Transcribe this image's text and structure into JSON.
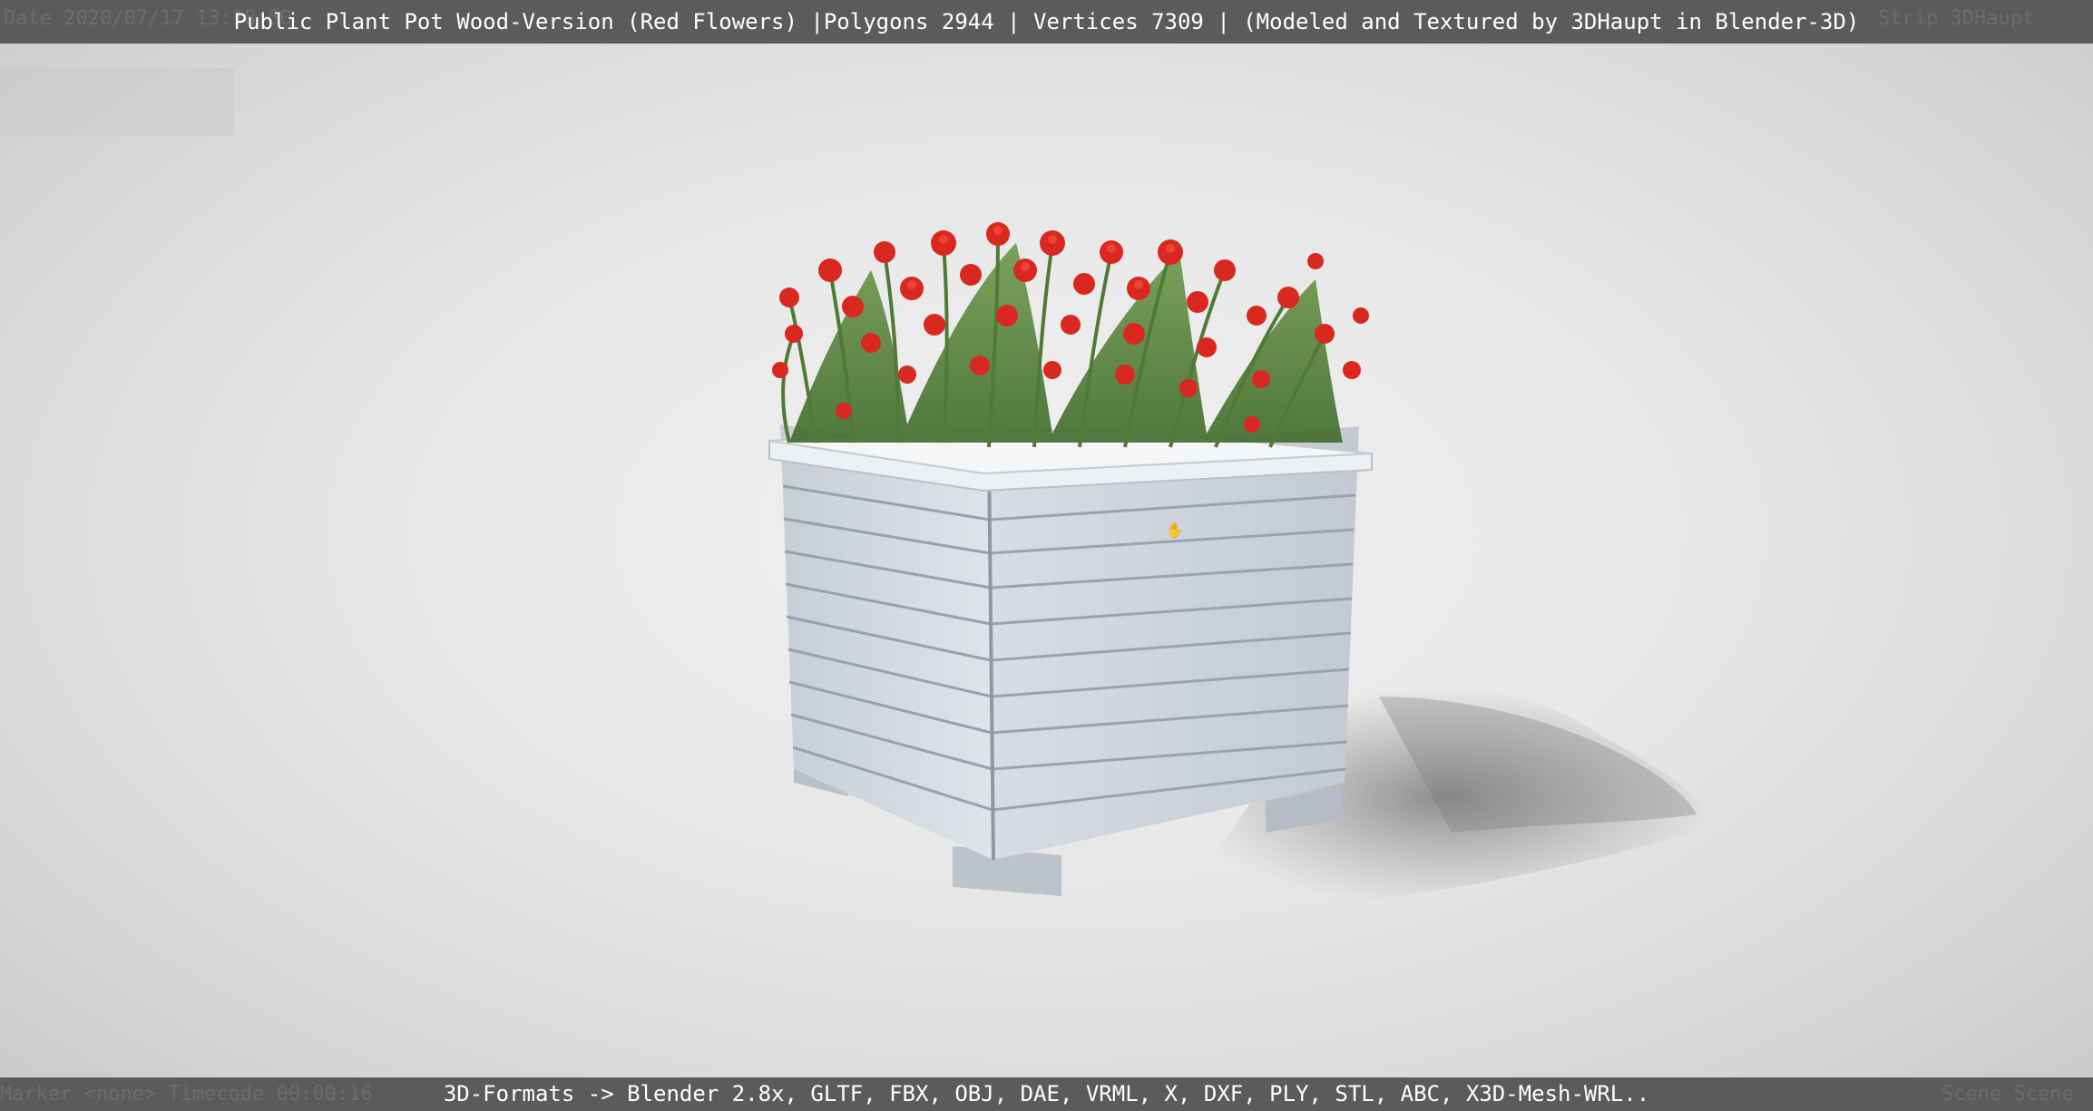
{
  "header": {
    "title": "Public Plant Pot Wood-Version (Red Flowers) |Polygons 2944 | Vertices 7309 | (Modeled and Textured by 3DHaupt in Blender-3D)",
    "ghost_left": "Date 2020/07/17 13:18:50",
    "ghost_right": "Strip 3DHaupt"
  },
  "footer": {
    "formats": "3D-Formats -> Blender 2.8x, GLTF, FBX, OBJ, DAE, VRML, X, DXF, PLY, STL, ABC, X3D-Mesh-WRL..",
    "ghost_left": "Marker <none>  Timecode 00:00:16",
    "ghost_right": "Scene Scene"
  },
  "viewport": {
    "subject": "wooden-planter-red-flowers",
    "colors": {
      "background": "#e7e7e7",
      "planter": "#d8dde3",
      "planter_shadow": "#9aa2ac",
      "flower": "#d9281f",
      "stem": "#4f7a36"
    }
  },
  "cursor": {
    "icon": "hand-cursor-icon"
  }
}
